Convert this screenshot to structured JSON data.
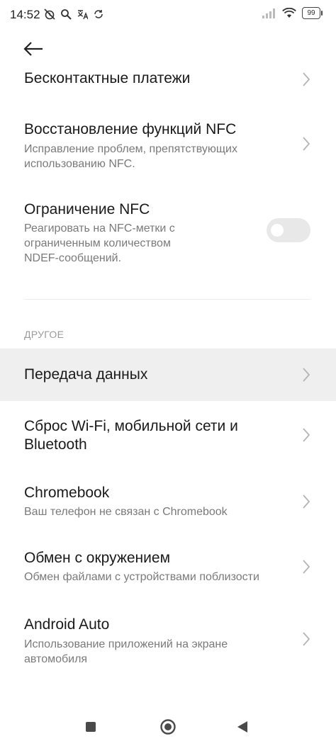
{
  "status_bar": {
    "time": "14:52",
    "battery": "99",
    "left_icons": [
      "muted-alarm-icon",
      "search-icon",
      "translate-icon",
      "sync-icon"
    ],
    "right_icons": [
      "signal-icon",
      "wifi-icon",
      "battery-icon"
    ]
  },
  "header": {
    "back_icon": "arrow-left-icon"
  },
  "items": [
    {
      "title": "Бесконтактные платежи"
    },
    {
      "title": "Восстановление функций NFC",
      "subtitle": "Исправление проблем, препятствующих использованию NFC."
    },
    {
      "title": "Ограничение NFC",
      "subtitle": "Реагировать на NFC-метки с ограниченным количеством NDEF-сообщений.",
      "toggle_on": false
    }
  ],
  "section": {
    "header": "ДРУГОЕ"
  },
  "other_items": [
    {
      "title": "Передача данных",
      "highlighted": true
    },
    {
      "title": "Сброс Wi-Fi, мобильной сети и Bluetooth"
    },
    {
      "title": "Chromebook",
      "subtitle": "Ваш телефон не связан с Chromebook"
    },
    {
      "title": "Обмен с окружением",
      "subtitle": "Обмен файлами с устройствами поблизости"
    },
    {
      "title": "Android Auto",
      "subtitle": "Использование приложений на экране автомобиля"
    }
  ],
  "nav_bar": {
    "icons": [
      "recents-icon",
      "home-icon",
      "back-icon"
    ]
  },
  "colors": {
    "highlight": "#efefef",
    "toggle_off": "#e8e8e8",
    "subtitle": "#7a7a7a"
  }
}
